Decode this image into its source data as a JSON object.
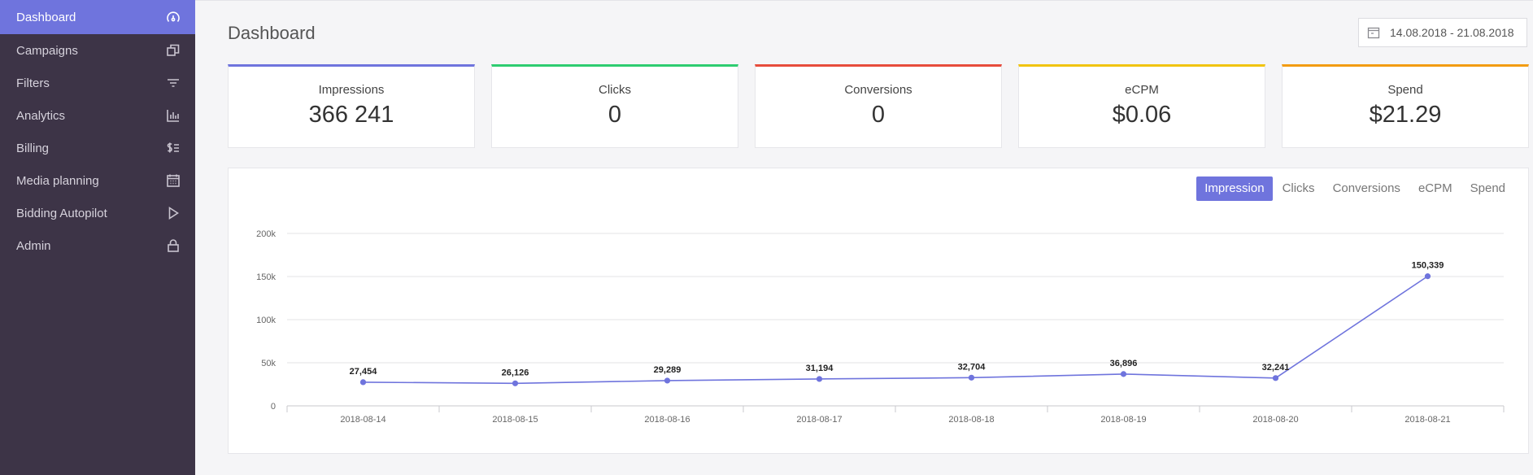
{
  "sidebar": {
    "items": [
      {
        "label": "Dashboard",
        "icon": "gauge-icon",
        "active": true
      },
      {
        "label": "Campaigns",
        "icon": "copy-icon"
      },
      {
        "label": "Filters",
        "icon": "filter-icon"
      },
      {
        "label": "Analytics",
        "icon": "bar-chart-icon"
      },
      {
        "label": "Billing",
        "icon": "dollar-list-icon"
      },
      {
        "label": "Media planning",
        "icon": "calendar-grid-icon"
      },
      {
        "label": "Bidding Autopilot",
        "icon": "play-icon"
      },
      {
        "label": "Admin",
        "icon": "lock-icon"
      }
    ]
  },
  "header": {
    "title": "Dashboard",
    "date_range": "14.08.2018 - 21.08.2018"
  },
  "cards": [
    {
      "label": "Impressions",
      "value": "366 241",
      "color": "#6f74dd"
    },
    {
      "label": "Clicks",
      "value": "0",
      "color": "#2ecc71"
    },
    {
      "label": "Conversions",
      "value": "0",
      "color": "#e74c3c"
    },
    {
      "label": "eCPM",
      "value": "$0.06",
      "color": "#f1c40f"
    },
    {
      "label": "Spend",
      "value": "$21.29",
      "color": "#f39c12"
    }
  ],
  "chart_tabs": [
    {
      "label": "Impression",
      "active": true
    },
    {
      "label": "Clicks"
    },
    {
      "label": "Conversions"
    },
    {
      "label": "eCPM"
    },
    {
      "label": "Spend"
    }
  ],
  "colors": {
    "accent": "#6f74dd",
    "sidebar_bg": "#3d3447"
  },
  "chart_data": {
    "type": "line",
    "categories": [
      "2018-08-14",
      "2018-08-15",
      "2018-08-16",
      "2018-08-17",
      "2018-08-18",
      "2018-08-19",
      "2018-08-20",
      "2018-08-21"
    ],
    "values": [
      27454,
      26126,
      29289,
      31194,
      32704,
      36896,
      32241,
      150339
    ],
    "data_labels": [
      "27,454",
      "26,126",
      "29,289",
      "31,194",
      "32,704",
      "36,896",
      "32,241",
      "150,339"
    ],
    "y_ticks": [
      0,
      50000,
      100000,
      150000,
      200000
    ],
    "y_tick_labels": [
      "0",
      "50k",
      "100k",
      "150k",
      "200k"
    ],
    "ylim": [
      0,
      200000
    ],
    "grid": true,
    "line_color": "#6f74dd"
  }
}
